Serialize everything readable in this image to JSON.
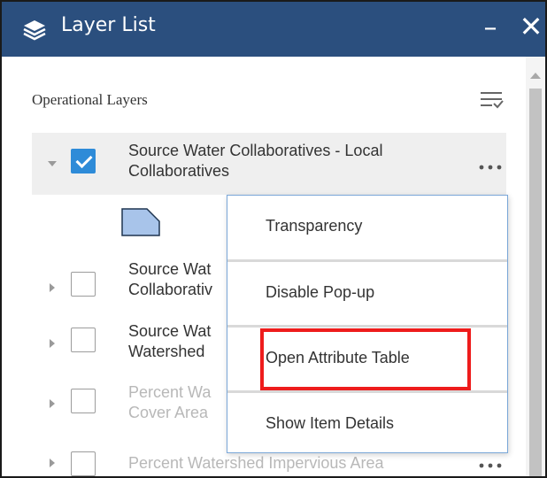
{
  "panel": {
    "title": "Layer List",
    "icons": {
      "layers": "layers-icon",
      "minimize": "minimize-icon",
      "close": "close-icon"
    },
    "minimize_glyph": "–",
    "close_glyph": "✕",
    "header_color": "#2b4f7e"
  },
  "section": {
    "label": "Operational Layers",
    "options_icon": "layer-options-icon"
  },
  "layers": [
    {
      "label": "Source Water Collaboratives - Local Collaboratives",
      "checked": true,
      "expanded": true,
      "enabled": true
    },
    {
      "label": "Source Wat",
      "label_line2": "Collaborativ",
      "checked": false,
      "expanded": false,
      "enabled": true
    },
    {
      "label": "Source Wat",
      "label_line2": "Watershed",
      "checked": false,
      "expanded": false,
      "enabled": true
    },
    {
      "label": "Percent Wa",
      "label_line2": "Cover Area",
      "checked": false,
      "expanded": false,
      "enabled": false
    },
    {
      "label": "Percent Watershed Impervious Area",
      "checked": false,
      "expanded": false,
      "enabled": false
    }
  ],
  "legend": {
    "swatch_color": "#a8c4ea",
    "swatch_outline": "#1f3550"
  },
  "context_menu": {
    "items": [
      {
        "label": "Transparency"
      },
      {
        "label": "Disable Pop-up"
      },
      {
        "label": "Open Attribute Table",
        "highlighted": true
      },
      {
        "label": "Show Item Details"
      }
    ],
    "highlight_color": "#ee1c1c",
    "border_color": "#7aa7d8"
  },
  "more_glyph": "•••",
  "accent": "#2e8bd8"
}
